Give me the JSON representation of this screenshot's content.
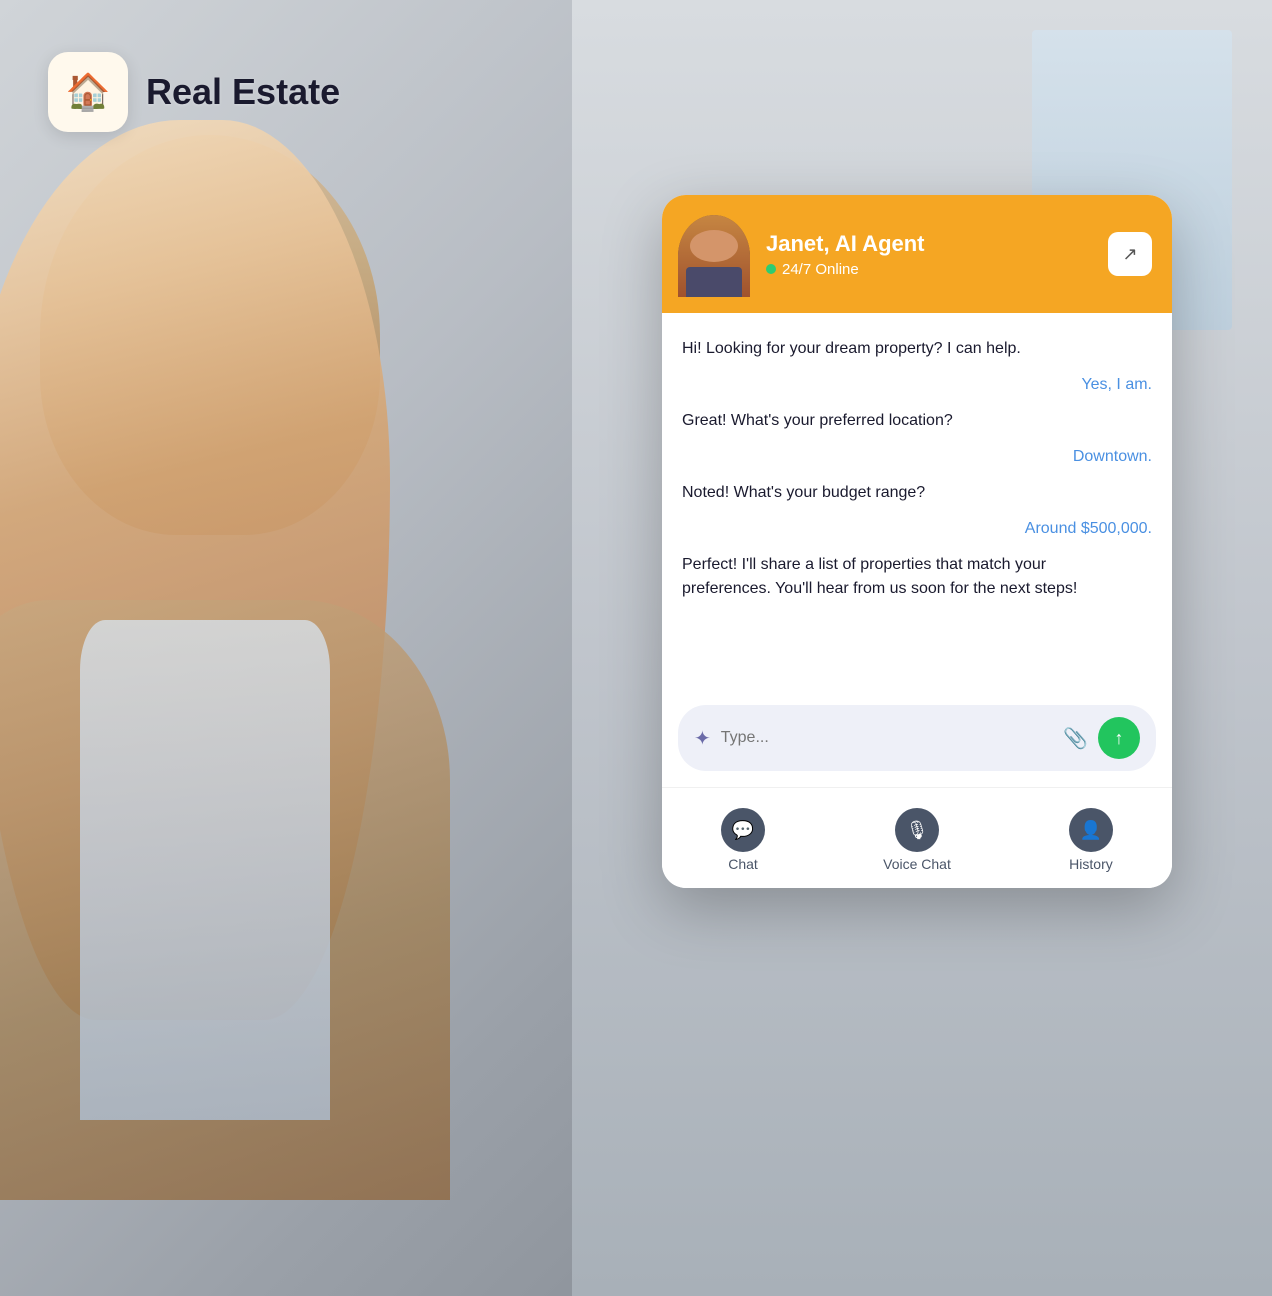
{
  "app": {
    "title": "Real Estate",
    "logo_icon": "🏠"
  },
  "chat": {
    "agent_name": "Janet, AI Agent",
    "agent_status": "24/7 Online",
    "messages": [
      {
        "type": "bot",
        "text": "Hi! Looking for your dream property? I can help."
      },
      {
        "type": "user",
        "text": "Yes, I am."
      },
      {
        "type": "bot",
        "text": "Great! What's your preferred location?"
      },
      {
        "type": "user",
        "text": "Downtown."
      },
      {
        "type": "bot",
        "text": "Noted! What's your budget range?"
      },
      {
        "type": "user",
        "text": "Around $500,000."
      },
      {
        "type": "bot",
        "text": "Perfect! I'll share a list of properties that match your preferences. You'll hear from us soon for the next steps!"
      }
    ],
    "input_placeholder": "Type...",
    "expand_button_label": "↗",
    "nav_items": [
      {
        "id": "chat",
        "label": "Chat",
        "icon": "💬"
      },
      {
        "id": "voice-chat",
        "label": "Voice Chat",
        "icon": "🎙"
      },
      {
        "id": "history",
        "label": "History",
        "icon": "👤"
      }
    ]
  },
  "colors": {
    "orange_accent": "#f5a623",
    "online_green": "#2ecc71",
    "send_green": "#22c55e",
    "user_msg_blue": "#4a90e2",
    "bot_msg_dark": "#1a1a2e",
    "nav_icon_bg": "#4a5568"
  }
}
